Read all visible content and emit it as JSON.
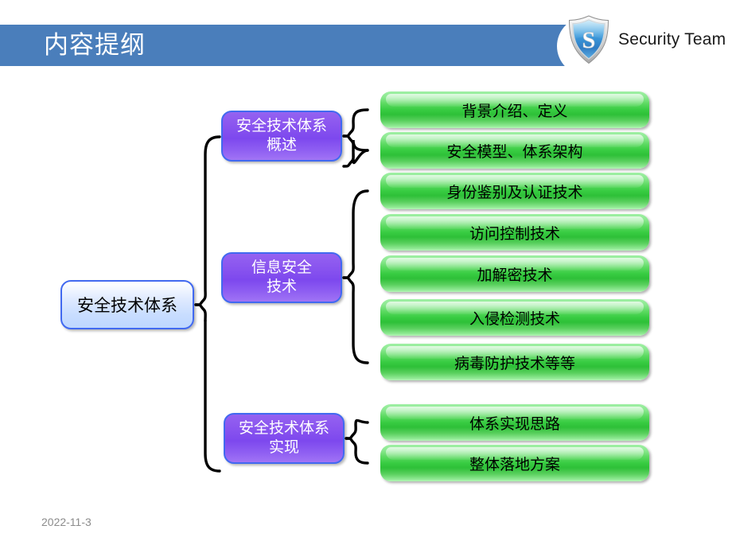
{
  "slide": {
    "title": "内容提纲",
    "date": "2022-11-3",
    "background_color": "#ffffff",
    "header_color": "#4a7ebb"
  },
  "brand": {
    "name": "Security Team",
    "logo_icon": "shield-icon",
    "shield_letter": "S",
    "shield_color": "#3b93d9"
  },
  "diagram": {
    "type": "bracket-tree",
    "root": {
      "label": "安全技术体系",
      "fill": "#c8ddff",
      "border": "#4169f0"
    },
    "branches": [
      {
        "label": "安全技术体系\n概述",
        "fill": "#7d48ee",
        "leaves": [
          "背景介绍、定义",
          "安全模型、体系架构"
        ]
      },
      {
        "label": "信息安全\n技术",
        "fill": "#7d48ee",
        "leaves": [
          "身份鉴别及认证技术",
          "访问控制技术",
          "加解密技术",
          "入侵检测技术",
          "病毒防护技术等等"
        ]
      },
      {
        "label": "安全技术体系\n实现",
        "fill": "#7d48ee",
        "leaves": [
          "体系实现思路",
          "整体落地方案"
        ]
      }
    ],
    "leaf_fill": "#38cc42"
  }
}
